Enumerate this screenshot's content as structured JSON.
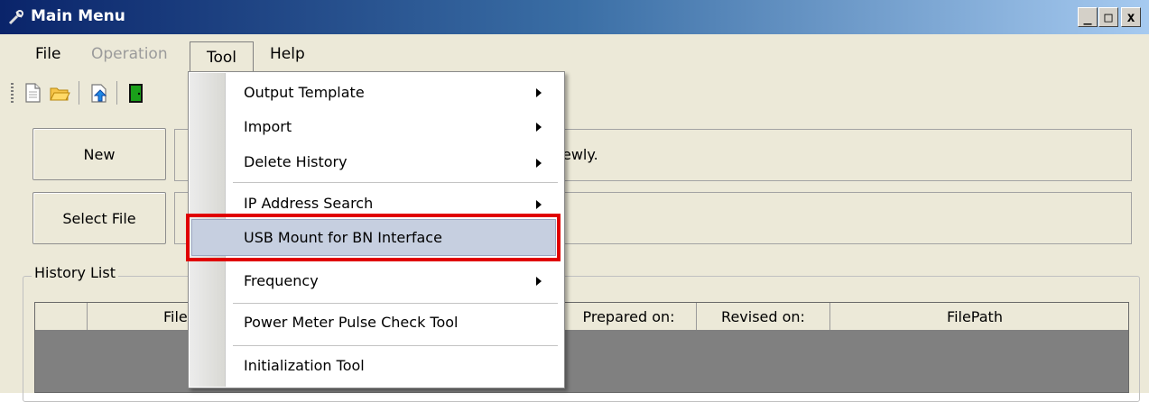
{
  "window": {
    "title": "Main Menu",
    "minimize": "_",
    "maximize": "□",
    "close": "x"
  },
  "menubar": {
    "file": "File",
    "operation": "Operation",
    "tool": "Tool",
    "help": "Help"
  },
  "toolbar": {
    "icons": [
      "new-document-icon",
      "open-folder-icon",
      "upload-icon",
      "exit-door-icon"
    ]
  },
  "main": {
    "new_button": "New",
    "select_file_button": "Select File",
    "new_field_glyph": "(",
    "new_field_text": "ewly.",
    "select_field_glyph": "|"
  },
  "history": {
    "label": "History List",
    "columns": [
      "",
      "File",
      "Prepared on:",
      "Revised on:",
      "FilePath"
    ]
  },
  "tool_menu": {
    "items": [
      {
        "label": "Output Template",
        "submenu": true
      },
      {
        "label": "Import",
        "submenu": true
      },
      {
        "label": "Delete History",
        "submenu": true
      },
      {
        "label": "IP Address Search",
        "submenu": true
      },
      {
        "label": "USB Mount for BN Interface",
        "submenu": false,
        "highlighted": true
      },
      {
        "label": "Frequency",
        "submenu": true
      },
      {
        "label": "Power Meter Pulse Check Tool",
        "submenu": false
      },
      {
        "label": "Initialization Tool",
        "submenu": false
      }
    ]
  },
  "colors": {
    "title_bar_start": "#0a246a",
    "highlight": "#c6cfe0",
    "annotation_box": "#e00000"
  }
}
